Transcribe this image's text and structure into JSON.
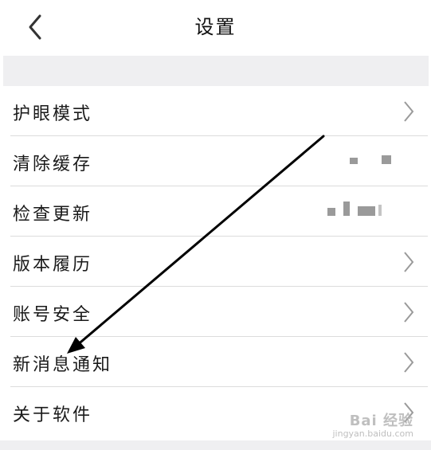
{
  "header": {
    "title": "设置",
    "back_icon": "chevron-left-icon"
  },
  "settings": {
    "items": [
      {
        "label": "护眼模式",
        "accessory": "chevron-right-icon"
      },
      {
        "label": "清除缓存",
        "accessory": "redacted-value"
      },
      {
        "label": "检查更新",
        "accessory": "redacted-value"
      },
      {
        "label": "版本履历",
        "accessory": "chevron-right-icon"
      },
      {
        "label": "账号安全",
        "accessory": "chevron-right-icon"
      },
      {
        "label": "新消息通知",
        "accessory": "chevron-right-icon"
      },
      {
        "label": "关于软件",
        "accessory": "chevron-right-icon"
      }
    ]
  },
  "annotation": {
    "type": "arrow",
    "points_to": "新消息通知",
    "color": "#000000"
  },
  "watermark": {
    "main": "Bai 经验",
    "sub": "jingyan.baidu.com"
  },
  "colors": {
    "background": "#ffffff",
    "band": "#efeff1",
    "separator": "#dcdcdc",
    "chevron": "#9a9a9a"
  }
}
